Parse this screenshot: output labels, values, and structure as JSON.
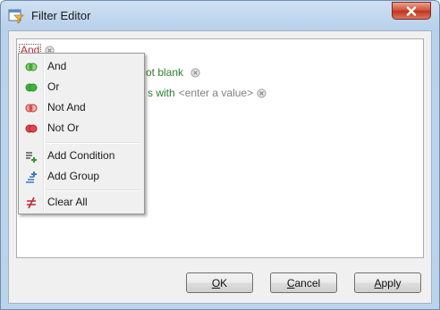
{
  "window": {
    "title": "Filter Editor",
    "icon": "filter-editor-icon",
    "close_icon": "close-icon"
  },
  "editor": {
    "root_group_label": "And",
    "conditions": [
      {
        "operator_partial": "ot blank",
        "remove_icon": "remove-circle-icon"
      },
      {
        "operator_partial": "s with",
        "value_placeholder": "<enter a value>",
        "remove_icon": "remove-circle-icon"
      }
    ]
  },
  "menu": {
    "items": [
      {
        "label": "And",
        "icon": "and-group-icon",
        "color": "#3aa33a"
      },
      {
        "label": "Or",
        "icon": "or-group-icon",
        "color": "#3aa33a"
      },
      {
        "label": "Not And",
        "icon": "not-and-group-icon",
        "color": "#d9534f"
      },
      {
        "label": "Not Or",
        "icon": "not-or-group-icon",
        "color": "#d9534f"
      }
    ],
    "actions": [
      {
        "label": "Add Condition",
        "icon": "add-condition-icon"
      },
      {
        "label": "Add Group",
        "icon": "add-group-icon"
      }
    ],
    "clear": {
      "label": "Clear All",
      "icon": "clear-all-icon"
    }
  },
  "buttons": {
    "ok": {
      "mnemonic": "O",
      "rest": "K"
    },
    "cancel": {
      "mnemonic": "C",
      "rest": "ancel"
    },
    "apply": {
      "mnemonic": "A",
      "rest": "pply"
    }
  },
  "colors": {
    "accent_red": "#c0282d",
    "condition_green": "#2d7d2d",
    "placeholder_gray": "#808080"
  }
}
